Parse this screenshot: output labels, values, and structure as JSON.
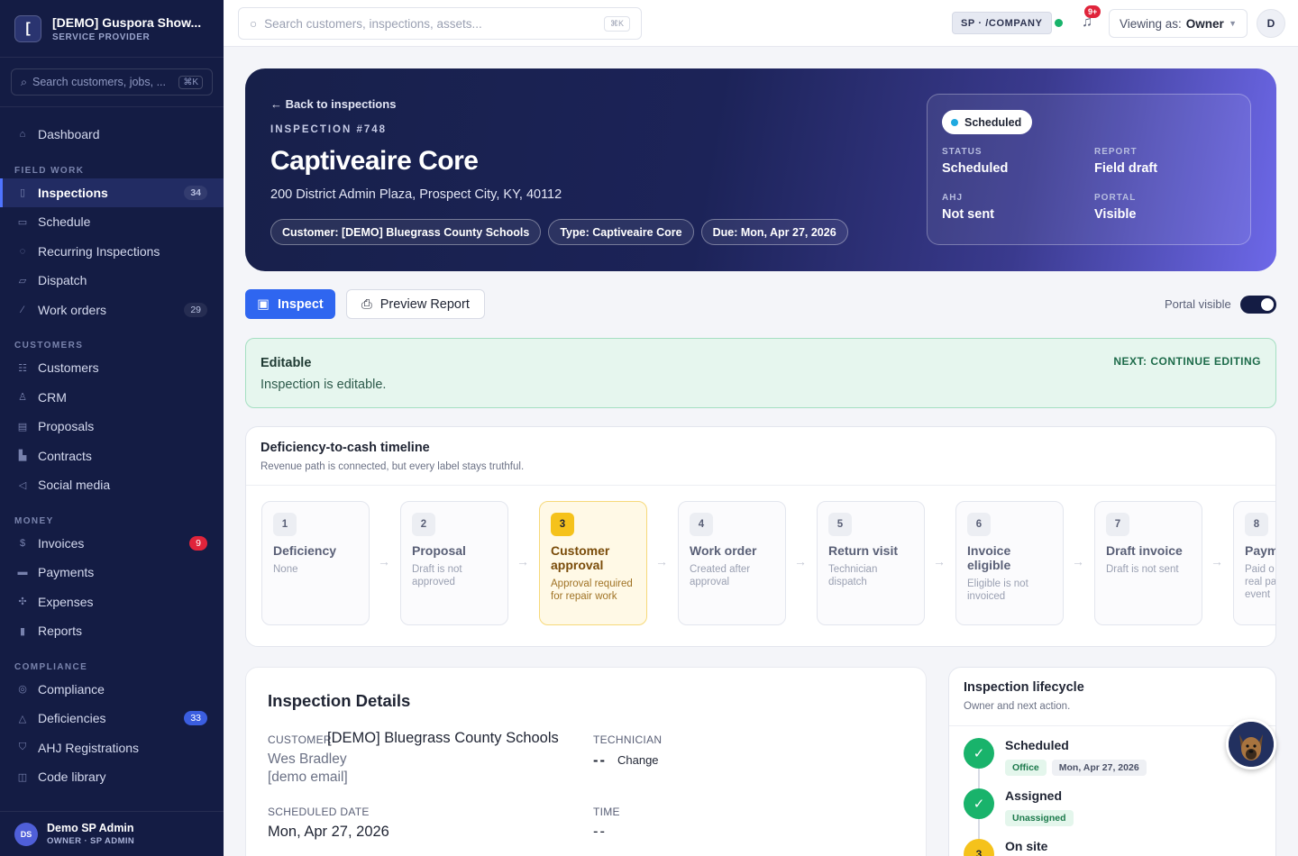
{
  "brand": {
    "name": "[DEMO] Guspora Show...",
    "sub": "SERVICE PROVIDER",
    "logo_glyph": "["
  },
  "sidebar": {
    "search_placeholder": "Search customers, jobs, ...",
    "search_kbd": "⌘K",
    "top_items": [
      {
        "label": "Dashboard",
        "icon": "home-icon"
      }
    ],
    "sections": [
      {
        "title": "FIELD WORK",
        "items": [
          {
            "label": "Inspections",
            "count": "34",
            "active": true,
            "icon": "clipboard-icon"
          },
          {
            "label": "Schedule",
            "icon": "calendar-icon"
          },
          {
            "label": "Recurring Inspections",
            "icon": "repeat-icon"
          },
          {
            "label": "Dispatch",
            "icon": "truck-icon"
          },
          {
            "label": "Work orders",
            "count": "29",
            "icon": "wrench-icon"
          }
        ]
      },
      {
        "title": "CUSTOMERS",
        "items": [
          {
            "label": "Customers",
            "icon": "users-icon"
          },
          {
            "label": "CRM",
            "icon": "user-icon"
          },
          {
            "label": "Proposals",
            "icon": "file-icon"
          },
          {
            "label": "Contracts",
            "icon": "contract-icon"
          },
          {
            "label": "Social media",
            "icon": "megaphone-icon"
          }
        ]
      },
      {
        "title": "MONEY",
        "items": [
          {
            "label": "Invoices",
            "count": "9",
            "badge": "red",
            "icon": "dollar-icon"
          },
          {
            "label": "Payments",
            "icon": "card-icon"
          },
          {
            "label": "Expenses",
            "icon": "expense-icon"
          },
          {
            "label": "Reports",
            "icon": "chart-icon"
          }
        ]
      },
      {
        "title": "COMPLIANCE",
        "items": [
          {
            "label": "Compliance",
            "icon": "check-circle-icon"
          },
          {
            "label": "Deficiencies",
            "count": "33",
            "badge": "blue",
            "icon": "warning-icon"
          },
          {
            "label": "AHJ Registrations",
            "icon": "shield-icon"
          },
          {
            "label": "Code library",
            "icon": "book-icon"
          }
        ]
      }
    ],
    "user": {
      "initials": "DS",
      "name": "Demo SP Admin",
      "role": "OWNER · SP ADMIN"
    }
  },
  "topbar": {
    "search_placeholder": "Search customers, inspections, assets...",
    "search_kbd": "⌘K",
    "tenant": "SP · /COMPANY",
    "bell_badge": "9+",
    "viewing_label": "Viewing as:",
    "viewing_value": "Owner",
    "avatar": "D"
  },
  "hero": {
    "back": "← Back to inspections",
    "number": "INSPECTION #748",
    "title": "Captiveaire Core",
    "address": "200 District Admin Plaza, Prospect City, KY, 40112",
    "chips": [
      "Customer: [DEMO] Bluegrass County Schools",
      "Type: Captiveaire Core",
      "Due: Mon, Apr 27, 2026"
    ],
    "status_pill": "Scheduled",
    "fields": [
      {
        "k": "STATUS",
        "v": "Scheduled"
      },
      {
        "k": "REPORT",
        "v": "Field draft"
      },
      {
        "k": "AHJ",
        "v": "Not sent"
      },
      {
        "k": "PORTAL",
        "v": "Visible"
      }
    ]
  },
  "actions": {
    "inspect": "Inspect",
    "preview": "Preview Report",
    "portal_label": "Portal visible"
  },
  "editable": {
    "title": "Editable",
    "text": "Inspection is editable.",
    "next": "NEXT: CONTINUE EDITING"
  },
  "timeline": {
    "title": "Deficiency-to-cash timeline",
    "subtitle": "Revenue path is connected, but every label stays truthful.",
    "steps": [
      {
        "n": "1",
        "title": "Deficiency",
        "desc": "None"
      },
      {
        "n": "2",
        "title": "Proposal",
        "desc": "Draft is not approved"
      },
      {
        "n": "3",
        "title": "Customer approval",
        "desc": "Approval required for repair work",
        "current": true
      },
      {
        "n": "4",
        "title": "Work order",
        "desc": "Created after approval"
      },
      {
        "n": "5",
        "title": "Return visit",
        "desc": "Technician dispatch"
      },
      {
        "n": "6",
        "title": "Invoice eligible",
        "desc": "Eligible is not invoiced"
      },
      {
        "n": "7",
        "title": "Draft invoice",
        "desc": "Draft is not sent"
      },
      {
        "n": "8",
        "title": "Paym",
        "desc": "Paid o real pa event"
      }
    ]
  },
  "details": {
    "title": "Inspection Details",
    "customer_label": "CUSTOMER",
    "customer_value": "[DEMO] Bluegrass County Schools",
    "contact_name": "Wes Bradley",
    "contact_email": "[demo email]",
    "technician_label": "TECHNICIAN",
    "technician_value": "--",
    "technician_action": "Change",
    "date_label": "SCHEDULED DATE",
    "date_value": "Mon, Apr 27, 2026",
    "time_label": "TIME",
    "time_value": "--"
  },
  "lifecycle": {
    "title": "Inspection lifecycle",
    "subtitle": "Owner and next action.",
    "items": [
      {
        "name": "Scheduled",
        "tags": [
          "Office",
          "Mon, Apr 27, 2026"
        ],
        "done": true
      },
      {
        "name": "Assigned",
        "tags": [
          "Unassigned"
        ],
        "done": true
      },
      {
        "name": "On site",
        "tags": [],
        "n": "3"
      }
    ]
  }
}
